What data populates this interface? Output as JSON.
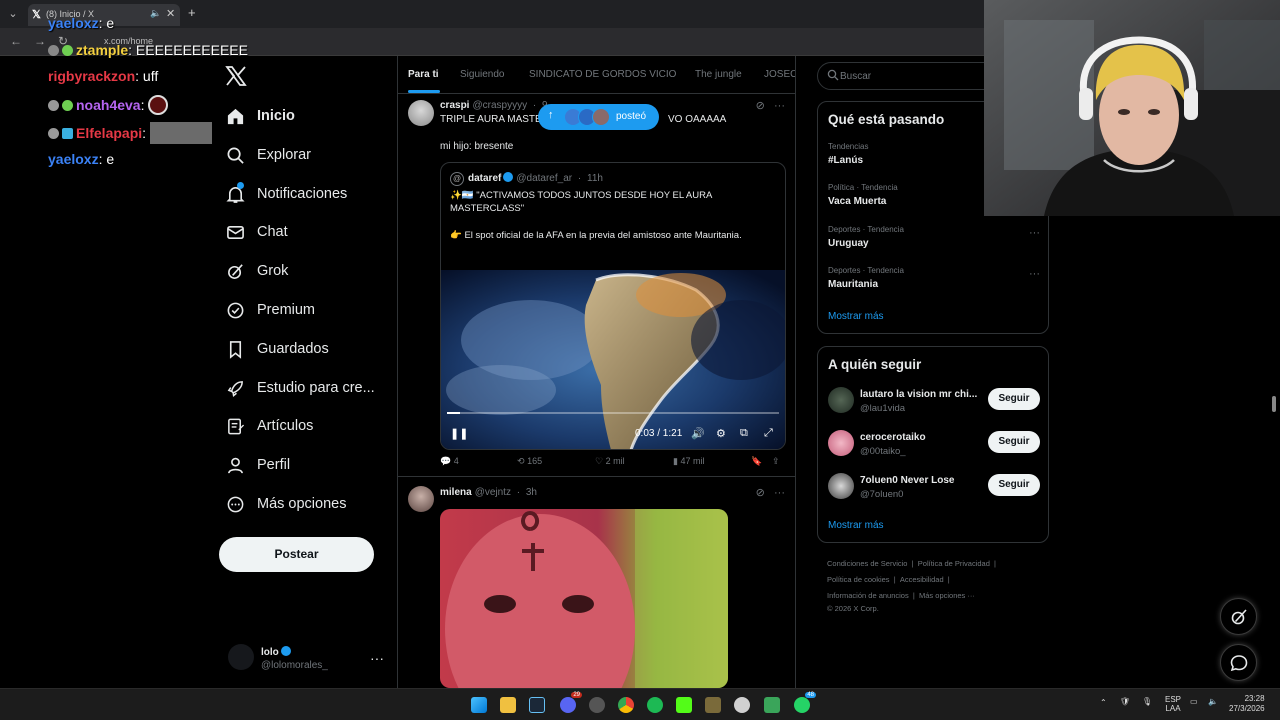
{
  "browser": {
    "tab_title": "(8) Inicio / X",
    "url": "x.com/home"
  },
  "stream_chat": [
    {
      "user": "yaeloxz",
      "message": "e",
      "color": "#3b82f6"
    },
    {
      "user": "ztample",
      "message": "EEEEEEEEEEEE",
      "color": "#f4d03f"
    },
    {
      "user": "rigbyrackzon",
      "message": "uff",
      "color": "#e63946"
    },
    {
      "user": "noah4eva",
      "message": "",
      "color": "#b565f0"
    },
    {
      "user": "Elfelapapi",
      "message": "",
      "color": "#e63946"
    },
    {
      "user": "yaeloxz",
      "message": "e",
      "color": "#3b82f6"
    }
  ],
  "nav": {
    "items": [
      {
        "label": "Inicio",
        "icon": "home-icon"
      },
      {
        "label": "Explorar",
        "icon": "search-icon"
      },
      {
        "label": "Notificaciones",
        "icon": "bell-icon"
      },
      {
        "label": "Chat",
        "icon": "mail-icon"
      },
      {
        "label": "Grok",
        "icon": "grok-icon"
      },
      {
        "label": "Premium",
        "icon": "premium-icon"
      },
      {
        "label": "Guardados",
        "icon": "bookmark-icon"
      },
      {
        "label": "Estudio para cre...",
        "icon": "rocket-icon"
      },
      {
        "label": "Artículos",
        "icon": "article-icon"
      },
      {
        "label": "Perfil",
        "icon": "person-icon"
      },
      {
        "label": "Más opciones",
        "icon": "more-circle-icon"
      }
    ],
    "post_button": "Postear",
    "profile": {
      "name": "lolo",
      "handle": "@lolomorales_"
    }
  },
  "feed_tabs": [
    "Para ti",
    "Siguiendo",
    "SINDICATO DE GORDOS VICIO",
    "The jungle",
    "JOSEO"
  ],
  "new_posts_pill": "posteó",
  "posts": [
    {
      "name": "craspi",
      "handle": "@craspyyyy",
      "time": "9",
      "text_line1_left": "TRIPLE AURA MASTE",
      "text_line1_right": "VO OAAAAA",
      "text_line2": "mi hijo: bresente",
      "quote": {
        "name": "dataref",
        "handle": "@dataref_ar",
        "time": "11h",
        "line1": "✨🇦🇷 \"ACTIVAMOS TODOS JUNTOS DESDE HOY EL AURA",
        "line2": "MASTERCLASS\"",
        "line3": "👉 El spot oficial de la AFA en la previa del amistoso ante Mauritania.",
        "video_time": "0:03 / 1:21",
        "video_progress": 0.04
      },
      "replies": "4",
      "reposts": "165",
      "likes": "2 mil",
      "views": "47 mil"
    },
    {
      "name": "milena",
      "handle": "@vejntz",
      "time": "3h"
    }
  ],
  "search": {
    "placeholder": "Buscar"
  },
  "trends": {
    "title": "Qué está pasando",
    "items": [
      {
        "category": "Tendencias",
        "name": "#Lanús"
      },
      {
        "category": "Política · Tendencia",
        "name": "Vaca Muerta"
      },
      {
        "category": "Deportes · Tendencia",
        "name": "Uruguay"
      },
      {
        "category": "Deportes · Tendencia",
        "name": "Mauritania"
      }
    ],
    "show_more": "Mostrar más"
  },
  "who_to_follow": {
    "title": "A quién seguir",
    "items": [
      {
        "name": "lautaro la vision mr chi...",
        "handle": "@lau1vida"
      },
      {
        "name": "cerocerotaiko",
        "handle": "@00taiko_"
      },
      {
        "name": "7oluen0 Never Lose",
        "handle": "@7oluen0"
      }
    ],
    "button": "Seguir",
    "show_more": "Mostrar más"
  },
  "footer": {
    "line1a": "Condiciones de Servicio",
    "line1b": "Política de Privacidad",
    "line2a": "Política de cookies",
    "line2b": "Accesibilidad",
    "line3a": "Información de anuncios",
    "line3b": "Más opciones ···",
    "line4": "© 2026 X Corp."
  },
  "taskbar": {
    "lang1": "ESP",
    "lang2": "LAA",
    "time": "23:28",
    "date": "27/3/2026",
    "badge_discord": "29",
    "badge_whatsapp": "48"
  },
  "colors": {
    "accent": "#1d9bf0",
    "background": "#000000",
    "border": "#2f3336",
    "muted": "#71767b"
  }
}
